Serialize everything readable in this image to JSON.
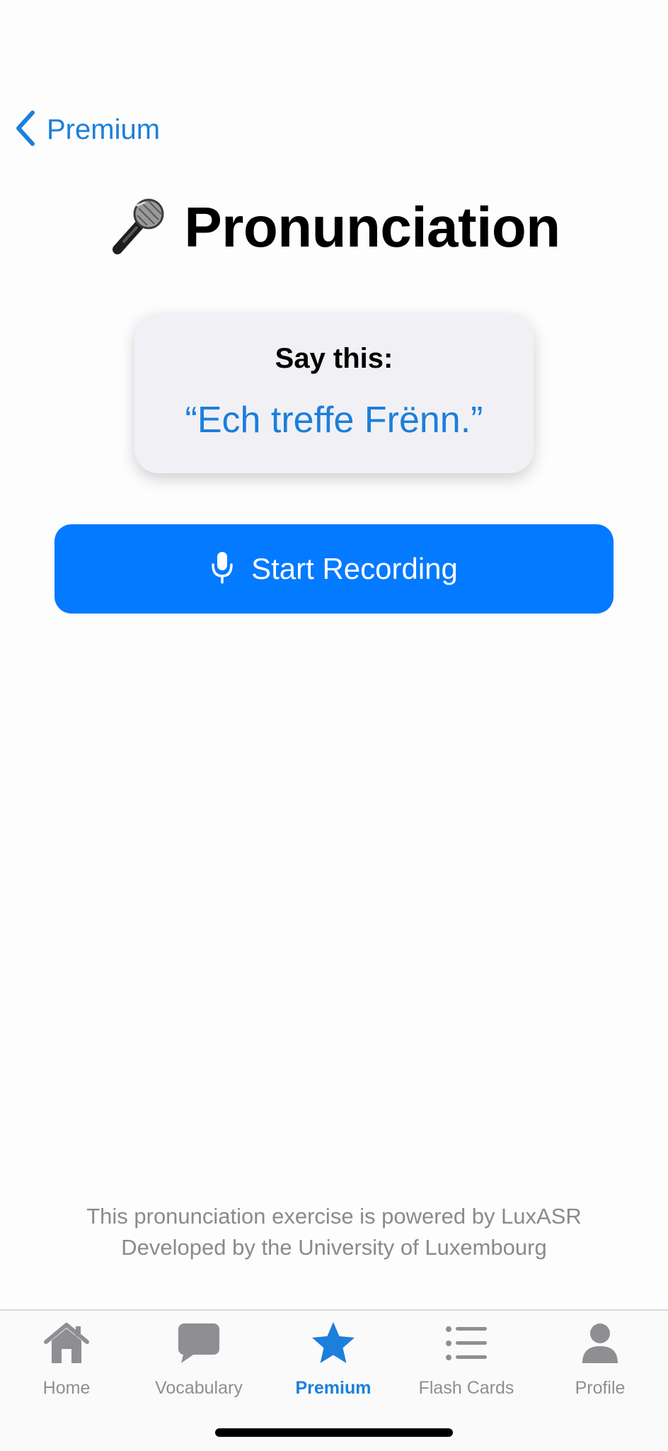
{
  "nav": {
    "back_label": "Premium",
    "back_icon": "chevron-left-icon"
  },
  "header": {
    "title": "Pronunciation",
    "title_icon": "microphone-emoji-icon"
  },
  "prompt": {
    "label": "Say this:",
    "phrase": "“Ech treffe Frënn.”"
  },
  "record_button": {
    "label": "Start Recording",
    "icon": "mic-icon"
  },
  "credits": {
    "line1": "This pronunciation exercise is powered by LuxASR",
    "line2": "Developed by the University of Luxembourg"
  },
  "tab_bar": {
    "tabs": [
      {
        "label": "Home",
        "icon": "house-icon",
        "active": false
      },
      {
        "label": "Vocabulary",
        "icon": "speech-bubble-icon",
        "active": false
      },
      {
        "label": "Premium",
        "icon": "star-icon",
        "active": true
      },
      {
        "label": "Flash Cards",
        "icon": "list-icon",
        "active": false
      },
      {
        "label": "Profile",
        "icon": "person-icon",
        "active": false
      }
    ]
  },
  "colors": {
    "accent": "#1b7fdb",
    "button": "#037aff",
    "inactive": "#8e8e93",
    "card_bg": "#f1f1f5"
  }
}
